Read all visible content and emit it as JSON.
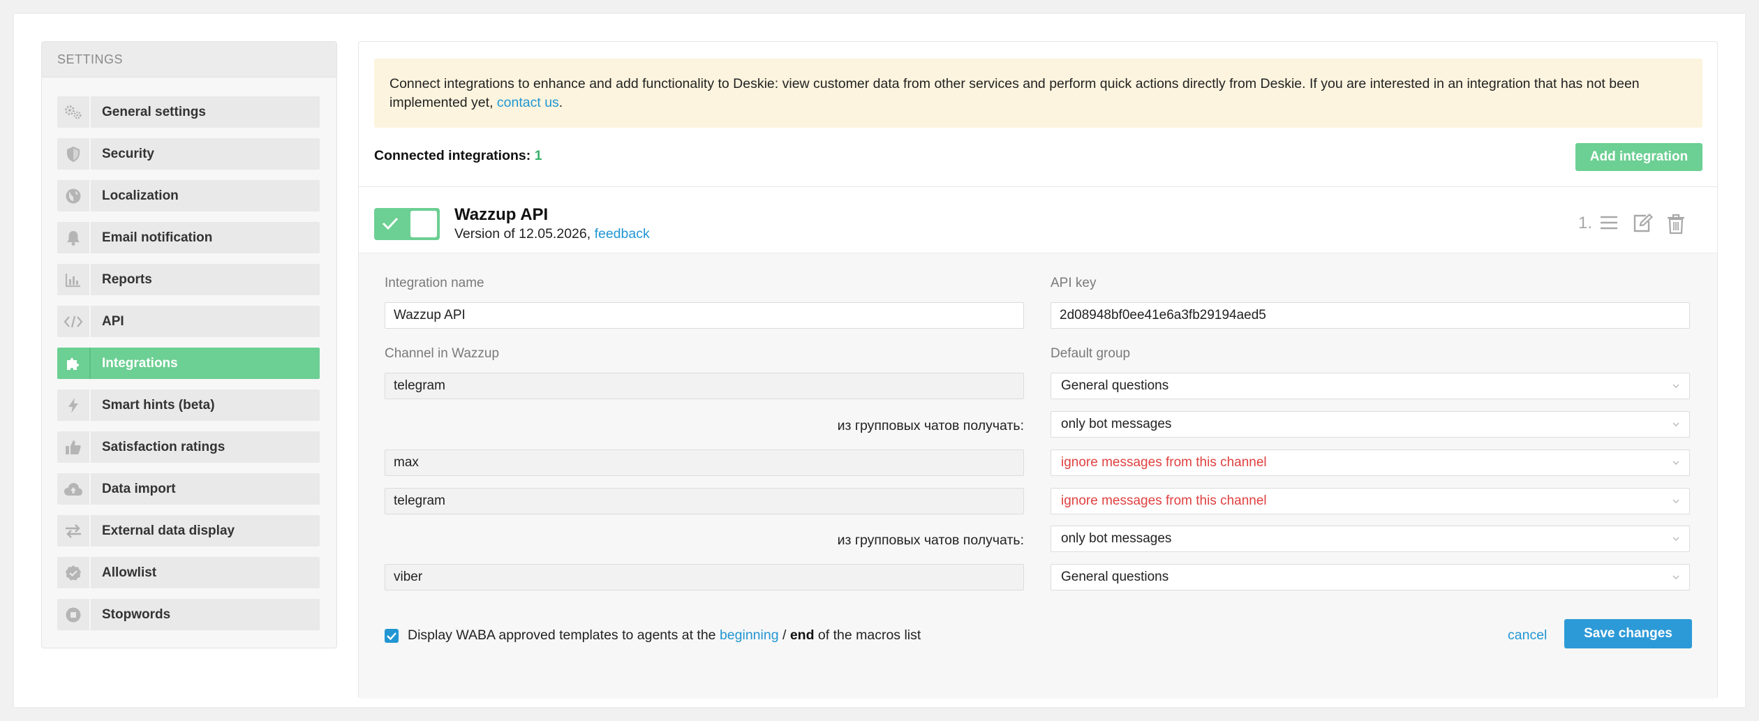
{
  "sidebar": {
    "header": "SETTINGS",
    "items": [
      {
        "label": "General settings",
        "icon": "gears-icon"
      },
      {
        "label": "Security",
        "icon": "shield-icon"
      },
      {
        "label": "Localization",
        "icon": "globe-icon"
      },
      {
        "label": "Email notification",
        "icon": "bell-icon"
      },
      {
        "label": "Reports",
        "icon": "bar-chart-icon"
      },
      {
        "label": "API",
        "icon": "code-icon"
      },
      {
        "label": "Integrations",
        "icon": "puzzle-icon",
        "active": true
      },
      {
        "label": "Smart hints (beta)",
        "icon": "lightning-icon"
      },
      {
        "label": "Satisfaction ratings",
        "icon": "thumbs-up-icon"
      },
      {
        "label": "Data import",
        "icon": "cloud-upload-icon"
      },
      {
        "label": "External data display",
        "icon": "arrows-exchange-icon"
      },
      {
        "label": "Allowlist",
        "icon": "check-badge-icon"
      },
      {
        "label": "Stopwords",
        "icon": "stop-circle-icon"
      }
    ]
  },
  "notice": {
    "text_before": "Connect integrations to enhance and add functionality to Deskie: view customer data from other services and perform quick actions directly from Deskie. If you are interested in an integration that has not been implemented yet, ",
    "link": "contact us",
    "text_after": "."
  },
  "connected": {
    "label": "Connected integrations:",
    "count": "1"
  },
  "add_button": "Add integration",
  "integration": {
    "name": "Wazzup API",
    "version_text": "Version of 12.05.2026,",
    "feedback_link": "feedback",
    "order": "1.",
    "enabled": true
  },
  "form": {
    "integration_name_label": "Integration name",
    "integration_name_value": "Wazzup API",
    "api_key_label": "API key",
    "api_key_value": "2d08948bf0ee41e6a3fb29194aed5",
    "channel_label": "Channel in Wazzup",
    "default_group_label": "Default group",
    "rows": [
      {
        "channel": "telegram",
        "group": "General questions",
        "group_error": false
      },
      {
        "subrow_label": "из групповых чатов получать:",
        "group": "only bot messages"
      },
      {
        "channel": "max",
        "group": "ignore messages from this channel",
        "group_error": true
      },
      {
        "channel": "telegram",
        "group": "ignore messages from this channel",
        "group_error": true
      },
      {
        "subrow_label": "из групповых чатов получать:",
        "group": "only bot messages"
      },
      {
        "channel": "viber",
        "group": "General questions",
        "group_error": false
      }
    ],
    "waba": {
      "checked": true,
      "text_before": "Display WABA approved templates to agents at the",
      "beginning": "beginning",
      "slash": "/",
      "end": "end",
      "text_after": "of the macros list"
    },
    "cancel": "cancel",
    "save": "Save changes"
  },
  "colors": {
    "accent_green": "#6ccf93",
    "link_blue": "#2196d3",
    "error_red": "#e04040",
    "notice_bg": "#fcf4de",
    "save_blue": "#2d9ad8"
  }
}
